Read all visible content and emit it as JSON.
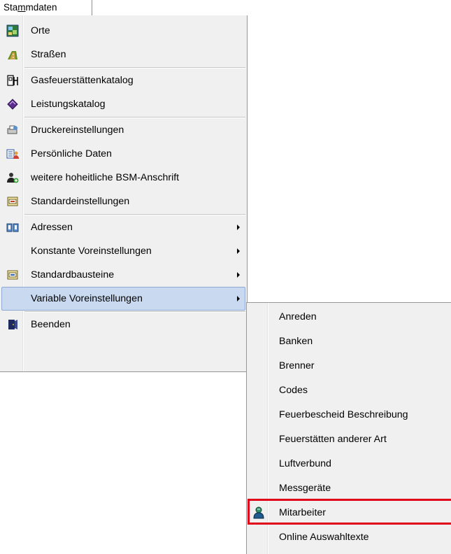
{
  "menubar": {
    "title_pre": "Sta",
    "title_ul": "m",
    "title_post": "mdaten"
  },
  "main_menu": {
    "orte": "Orte",
    "strassen": "Straßen",
    "gasfeuer": "Gasfeuerstättenkatalog",
    "leistung": "Leistungskatalog",
    "drucker": "Druckereinstellungen",
    "persoenlich": "Persönliche Daten",
    "hoheitlich": "weitere hoheitliche BSM-Anschrift",
    "standard": "Standardeinstellungen",
    "adressen": "Adressen",
    "konstante": "Konstante Voreinstellungen",
    "bausteine": "Standardbausteine",
    "variable": "Variable Voreinstellungen",
    "beenden": "Beenden"
  },
  "sub_menu": {
    "anreden": "Anreden",
    "banken": "Banken",
    "brenner": "Brenner",
    "codes": "Codes",
    "feuerbescheid": "Feuerbescheid Beschreibung",
    "feuerstaetten": "Feuerstätten anderer Art",
    "luftverbund": "Luftverbund",
    "messgeraete": "Messgeräte",
    "mitarbeiter": "Mitarbeiter",
    "online": "Online Auswahltexte"
  },
  "colors": {
    "highlight": "#c9d9ef",
    "redbox": "#e0001a",
    "menu_bg": "#f0f0f0"
  }
}
